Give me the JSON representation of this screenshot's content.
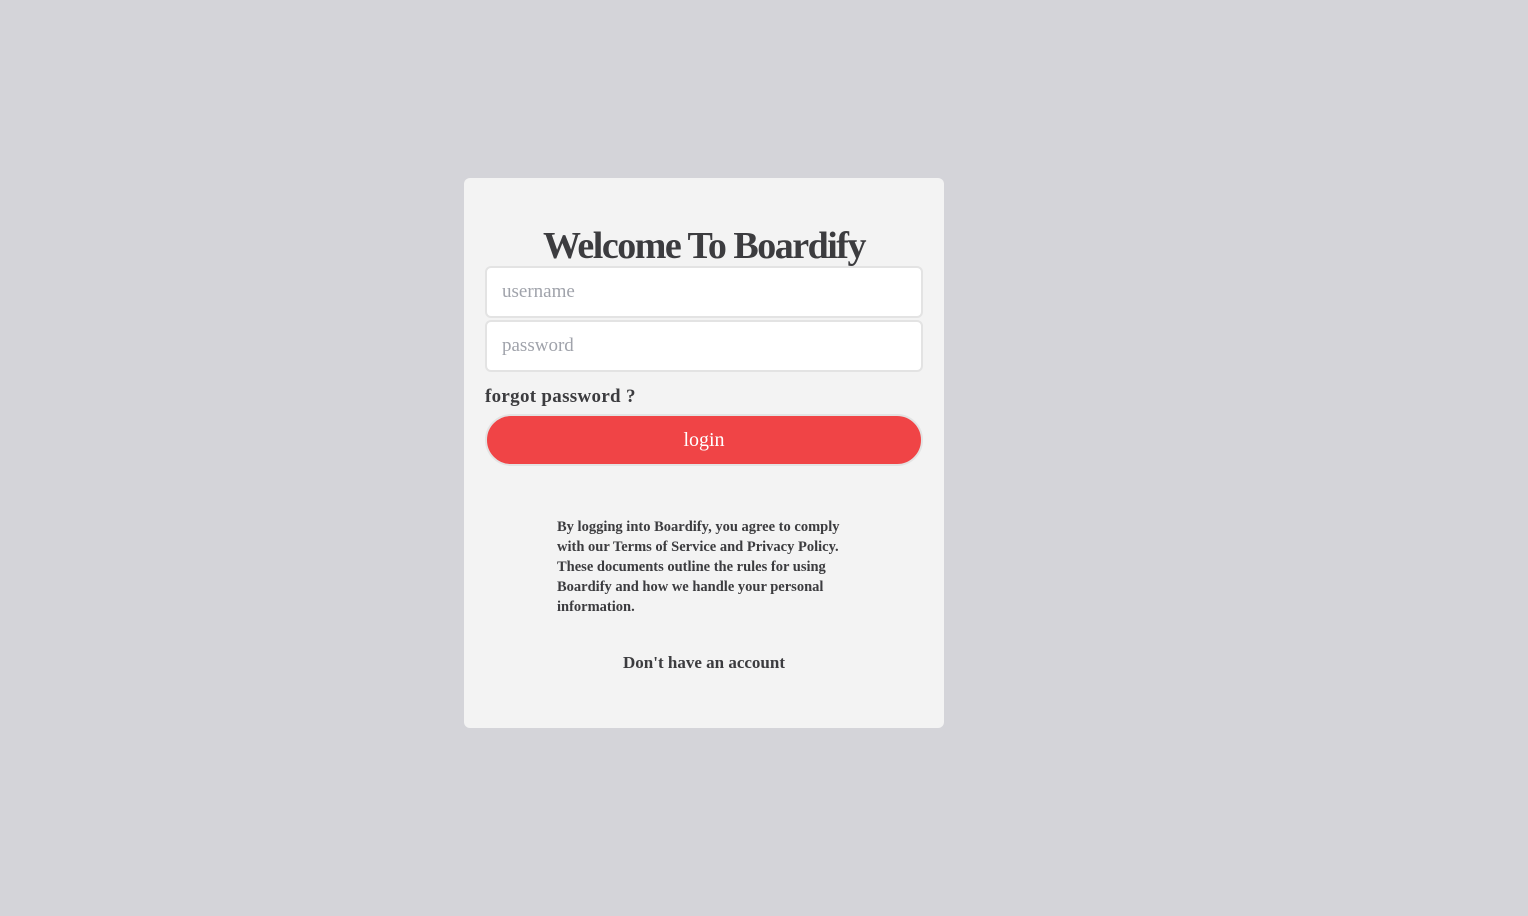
{
  "login": {
    "title": "Welcome To Boardify",
    "username_placeholder": "username",
    "password_placeholder": "password",
    "forgot_password": "forgot password ?",
    "login_label": "login",
    "terms_text": "By logging into Boardify, you agree to comply with our Terms of Service and Privacy Policy. These documents outline the rules for using Boardify and how we handle your personal information.",
    "signup_text": "Don't have an account"
  },
  "colors": {
    "background": "#d4d4d9",
    "card": "#f3f3f3",
    "accent": "#f04446",
    "text": "#3c3c3f",
    "placeholder": "#a0a3ab"
  }
}
